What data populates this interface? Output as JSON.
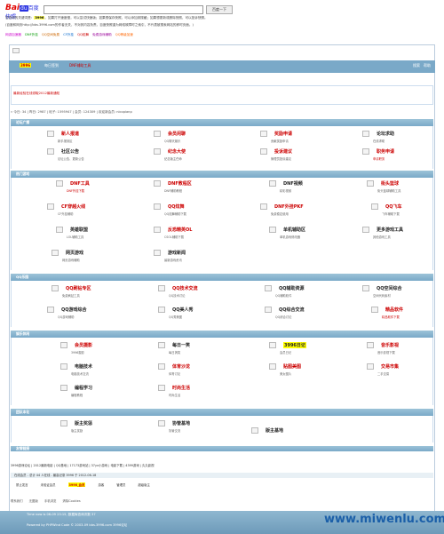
{
  "snapshot": {
    "logo_bai": "Bai",
    "logo_du": "du",
    "logo_kz": "百度快照",
    "search_button": "百度一下",
    "line1_prefix": "您查询的关键词是：",
    "line1_keyword": "3996",
    "line1_rest": "。如果打开速度慢，可以尝试快速版；如果想保存快照，可以添加到搜藏；如果想更新或删除快照，可以投诉快照。",
    "line2": "(百度和网页http://bbs.3996.com的作者无关，不对其内容负责。百度快照谨为网络故障时之索引，不代表被搜索网站的即时页面。)",
    "nav_colors": [
      "网游加速器",
      "DNF外挂",
      "QQ空间免费",
      "CF外挂",
      "QQ炫舞",
      "免费游戏辅助",
      "QQ等级加速"
    ]
  },
  "forum": {
    "topbar_logo": "3996",
    "topbar_items": [
      "每日签到",
      "DNF辅助工具"
    ],
    "topbar_right": [
      "搜索",
      "帮助"
    ],
    "notice": "最新经验在线领取2012最新通知",
    "breadcrumb": "» 今日: 34 | 昨日: 2987 | 帖子: 1595947 | 会员: 124309 | 欢迎新会员: nicopianp",
    "sections": [
      {
        "title": "论坛广播",
        "cells": [
          {
            "name": "新人报道",
            "sub": "新手报到区",
            "color": "red"
          },
          {
            "name": "会员闲聊",
            "sub": "QQ聊天娱乐",
            "color": "red"
          },
          {
            "name": "奖励申请",
            "sub": "贡献奖励申请",
            "color": "red"
          },
          {
            "name": "论坛求助",
            "sub": "在线求助",
            "color": "blk"
          },
          {
            "name": "社区公告",
            "sub": "论坛公告、更新公告",
            "color": "blk"
          },
          {
            "name": "纪念大使",
            "sub": "纪念版主任命",
            "color": "red"
          },
          {
            "name": "投诉建议",
            "sub": "管理员投诉建议",
            "color": "red"
          },
          {
            "name": "职务申请",
            "sub": "申请职务",
            "color": "red"
          }
        ]
      },
      {
        "title": "热门游戏",
        "cells": [
          {
            "name": "DNF工具",
            "sub": "DNF外挂下载",
            "color": "red"
          },
          {
            "name": "DNF教程区",
            "sub": "DNF辅助教程",
            "color": "red"
          },
          {
            "name": "DNF视频",
            "sub": "精彩视频",
            "color": "blk"
          },
          {
            "name": "街头篮球",
            "sub": "街头篮球辅助工具",
            "color": "red"
          },
          {
            "name": "CF穿越火线",
            "sub": "CF外挂辅助",
            "color": "red"
          },
          {
            "name": "QQ炫舞",
            "sub": "QQ炫舞辅助下载",
            "color": "red"
          },
          {
            "name": "DNF外挂PKF",
            "sub": "免费稳定使用",
            "color": "red"
          },
          {
            "name": "QQ飞车",
            "sub": "飞车辅助下载",
            "color": "red"
          },
          {
            "name": "英雄联盟",
            "sub": "LOL辅助工具",
            "color": "blk"
          },
          {
            "name": "反恐精英OL",
            "sub": "CSOL辅助下载",
            "color": "red"
          },
          {
            "name": "单机辅助区",
            "sub": "单机游戏修改器",
            "color": "blk"
          },
          {
            "name": "更多游戏工具",
            "sub": "其他游戏工具",
            "color": "blk"
          },
          {
            "name": "网页游戏",
            "sub": "网页游戏辅助",
            "color": "blk"
          },
          {
            "name": "游戏新闻",
            "sub": "最新游戏资讯",
            "color": "blk"
          }
        ]
      },
      {
        "title": "QQ乐园",
        "cells": [
          {
            "name": "QQ刷钻专区",
            "sub": "免费刷钻工具",
            "color": "red"
          },
          {
            "name": "QQ技术交流",
            "sub": "QQ技术讨论",
            "color": "red"
          },
          {
            "name": "QQ辅助资源",
            "sub": "QQ辅助软件",
            "color": "blk"
          },
          {
            "name": "QQ空间综合",
            "sub": "空间代码素材",
            "color": "blk"
          },
          {
            "name": "QQ游戏综合",
            "sub": "QQ游戏辅助",
            "color": "blk"
          },
          {
            "name": "QQ美人秀",
            "sub": "QQ秀美图",
            "color": "blk"
          },
          {
            "name": "QQ综合交流",
            "sub": "QQ综合讨论",
            "color": "blk"
          },
          {
            "name": "精品软件",
            "sub": "精品软件下载",
            "color": "red"
          }
        ]
      },
      {
        "title": "娱乐休闲",
        "cells": [
          {
            "name": "会员摄影",
            "sub": "3996摄影",
            "color": "red"
          },
          {
            "name": "每日一笑",
            "sub": "每日搞笑",
            "color": "blk"
          },
          {
            "name": "3996日记",
            "sub": "会员日记",
            "color": "blk"
          },
          {
            "name": "音乐影视",
            "sub": "音乐影视下载",
            "color": "red"
          },
          {
            "name": "电脑技术",
            "sub": "电脑技术交流",
            "color": "blk"
          },
          {
            "name": "体育沙龙",
            "sub": "体育讨论",
            "color": "red"
          },
          {
            "name": "贴图美图",
            "sub": "美女图片",
            "color": "red"
          },
          {
            "name": "交易市集",
            "sub": "二手交易",
            "color": "red"
          },
          {
            "name": "编程学习",
            "sub": "编程教程",
            "color": "blk"
          },
          {
            "name": "时尚生活",
            "sub": "时尚生活",
            "color": "red"
          }
        ]
      },
      {
        "title": "团队本化",
        "cells": [
          {
            "name": "版主奖惩",
            "sub": "版主奖励",
            "color": "blk"
          },
          {
            "name": "协管基地",
            "sub": "协管交流",
            "color": "blk"
          },
          {
            "name": "版主基地",
            "sub": "",
            "color": "blk"
          }
        ]
      }
    ],
    "links_title": "友情链接",
    "links": "3996游戏论坛 | 2012最新电影 | QQ基地 | 17173游戏站 | 37yx小游戏 | 电影下载 | 4399游戏 | 久久影视",
    "online": "在线会员 - 总计 44 人在线 - 最高记录 3996 于 2012-06-18",
    "legend": [
      "禁止发言",
      "未验证会员",
      "3996_会员",
      "游客",
      "管理员",
      "超级版主"
    ],
    "footer_links": [
      "联系我们",
      "无图版",
      "手机浏览",
      "清除Cookies"
    ],
    "bottom_time": "Time now is 06-09 23:15, 数据库查询次数 37",
    "bottom_powered": "Powered by PHPWind Code © 2003-09 bbs.3996.com 3996论坛",
    "watermark": "www.miwenlu.com"
  }
}
